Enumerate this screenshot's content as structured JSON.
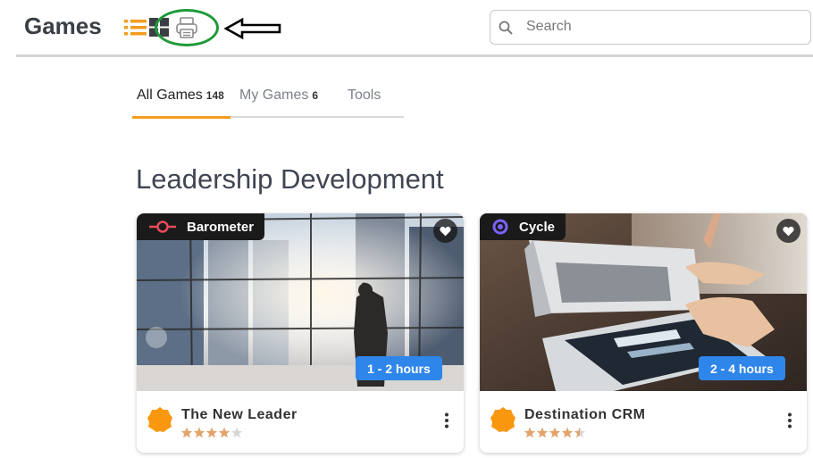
{
  "header": {
    "title": "Games",
    "icons": {
      "list": "list-view-icon",
      "grid": "grid-view-icon",
      "print": "printer-icon"
    },
    "search": {
      "placeholder": "Search",
      "value": "",
      "icon": "search-icon"
    }
  },
  "tabs": [
    {
      "label": "All Games",
      "count": "148",
      "active": true
    },
    {
      "label": "My Games",
      "count": "6",
      "active": false
    },
    {
      "label": "Tools",
      "count": "",
      "active": false
    }
  ],
  "section": {
    "title": "Leadership Development"
  },
  "cards": [
    {
      "tag": "Barometer",
      "tag_icon": "barometer-icon",
      "duration": "1 - 2 hours",
      "title": "The New Leader",
      "rating": 4,
      "rating_max": 5
    },
    {
      "tag": "Cycle",
      "tag_icon": "cycle-icon",
      "duration": "2 - 4 hours",
      "title": "Destination CRM",
      "rating": 4.5,
      "rating_max": 5
    }
  ],
  "colors": {
    "accent": "#f39c1f",
    "duration_badge": "#2f86ea",
    "annotation": "#1f9a3a",
    "star": "#e3a36a"
  }
}
